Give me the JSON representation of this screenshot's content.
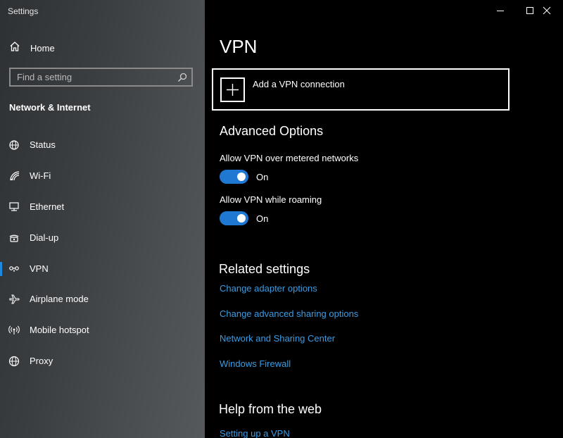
{
  "window": {
    "title": "Settings",
    "controls": {
      "minimize_icon": "minimize-icon",
      "maximize_icon": "maximize-icon",
      "close_icon": "close-icon"
    }
  },
  "sidebar": {
    "home_label": "Home",
    "search_placeholder": "Find a setting",
    "section_title": "Network & Internet",
    "items": [
      {
        "label": "Status",
        "icon": "globe-status-icon"
      },
      {
        "label": "Wi-Fi",
        "icon": "wifi-icon"
      },
      {
        "label": "Ethernet",
        "icon": "ethernet-icon"
      },
      {
        "label": "Dial-up",
        "icon": "dialup-icon"
      },
      {
        "label": "VPN",
        "icon": "vpn-icon",
        "selected": true
      },
      {
        "label": "Airplane mode",
        "icon": "airplane-icon"
      },
      {
        "label": "Mobile hotspot",
        "icon": "hotspot-icon"
      },
      {
        "label": "Proxy",
        "icon": "globe-icon"
      }
    ]
  },
  "main": {
    "title": "VPN",
    "add_vpn_label": "Add a VPN connection",
    "advanced": {
      "heading": "Advanced Options",
      "metered_label": "Allow VPN over metered networks",
      "metered_state": "On",
      "roaming_label": "Allow VPN while roaming",
      "roaming_state": "On"
    },
    "related": {
      "heading": "Related settings",
      "links": [
        "Change adapter options",
        "Change advanced sharing options",
        "Network and Sharing Center",
        "Windows Firewall"
      ]
    },
    "help": {
      "heading": "Help from the web",
      "links": [
        "Setting up a VPN"
      ]
    }
  },
  "colors": {
    "accent": "#1f78d1",
    "link": "#3a9de6",
    "selection_bar": "#1f8ae0"
  }
}
